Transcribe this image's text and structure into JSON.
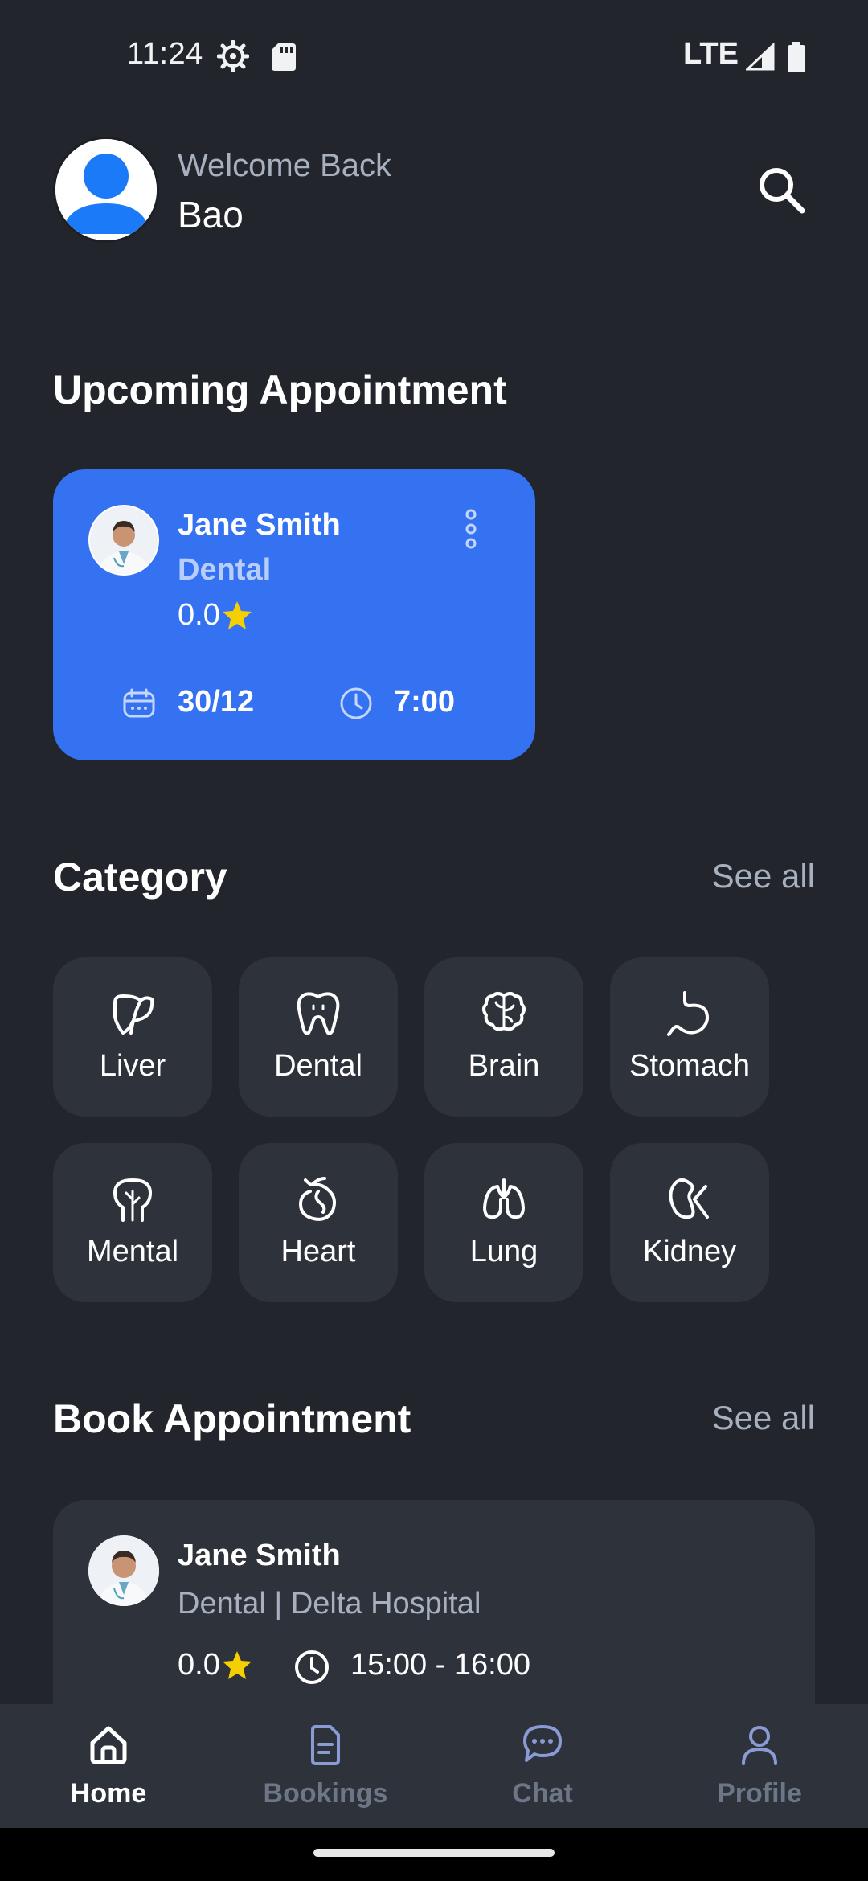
{
  "status_bar": {
    "time": "11:24",
    "network": "LTE"
  },
  "header": {
    "welcome": "Welcome Back",
    "username": "Bao"
  },
  "upcoming": {
    "title": "Upcoming Appointment",
    "card": {
      "doctor_name": "Jane Smith",
      "specialty": "Dental",
      "rating": "0.0",
      "date": "30/12",
      "time": "7:00",
      "background": "#3572f2"
    }
  },
  "category": {
    "title": "Category",
    "see_all": "See all",
    "items": [
      {
        "label": "Liver",
        "icon": "liver-icon"
      },
      {
        "label": "Dental",
        "icon": "tooth-icon"
      },
      {
        "label": "Brain",
        "icon": "brain-icon"
      },
      {
        "label": "Stomach",
        "icon": "stomach-icon"
      },
      {
        "label": "Mental",
        "icon": "mental-icon"
      },
      {
        "label": "Heart",
        "icon": "heart-icon"
      },
      {
        "label": "Lung",
        "icon": "lung-icon"
      },
      {
        "label": "Kidney",
        "icon": "kidney-icon"
      }
    ]
  },
  "book": {
    "title": "Book Appointment",
    "see_all": "See all",
    "card": {
      "doctor_name": "Jane Smith",
      "subtitle": "Dental | Delta Hospital",
      "rating": "0.0",
      "time_range": "15:00 - 16:00"
    }
  },
  "nav": {
    "items": [
      {
        "label": "Home",
        "icon": "home-icon",
        "active": true
      },
      {
        "label": "Bookings",
        "icon": "document-icon",
        "active": false
      },
      {
        "label": "Chat",
        "icon": "chat-icon",
        "active": false
      },
      {
        "label": "Profile",
        "icon": "profile-icon",
        "active": false
      }
    ]
  },
  "colors": {
    "background": "#22252b",
    "surface": "#2e323a",
    "accent": "#3572f2",
    "star": "#f5d000",
    "muted_text": "#a7b0be",
    "inactive_nav": "#6c7686"
  }
}
